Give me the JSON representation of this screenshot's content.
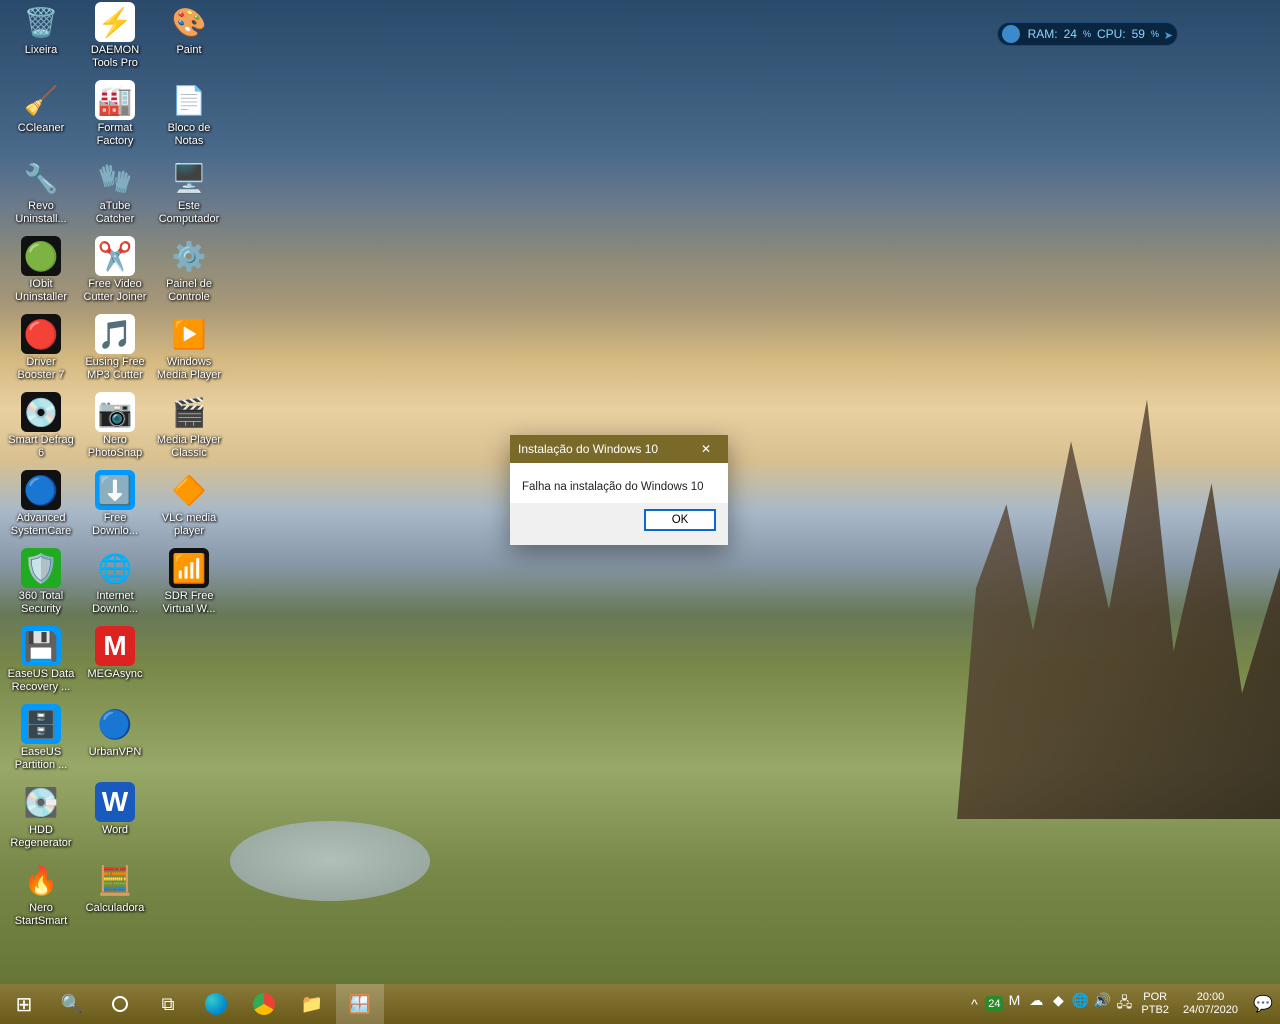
{
  "desktop_icons": [
    {
      "row": 0,
      "col": 0,
      "label": "Lixeira",
      "glyph": "🗑️",
      "bg": ""
    },
    {
      "row": 0,
      "col": 1,
      "label": "DAEMON Tools Pro",
      "glyph": "⚡",
      "bg": "#fff"
    },
    {
      "row": 0,
      "col": 2,
      "label": "Paint",
      "glyph": "🎨",
      "bg": ""
    },
    {
      "row": 1,
      "col": 0,
      "label": "CCleaner",
      "glyph": "🧹",
      "bg": ""
    },
    {
      "row": 1,
      "col": 1,
      "label": "Format Factory",
      "glyph": "🏭",
      "bg": "#fff"
    },
    {
      "row": 1,
      "col": 2,
      "label": "Bloco de Notas",
      "glyph": "📄",
      "bg": ""
    },
    {
      "row": 2,
      "col": 0,
      "label": "Revo Uninstall...",
      "glyph": "🔧",
      "bg": ""
    },
    {
      "row": 2,
      "col": 1,
      "label": "aTube Catcher",
      "glyph": "🧤",
      "bg": ""
    },
    {
      "row": 2,
      "col": 2,
      "label": "Este Computador",
      "glyph": "🖥️",
      "bg": ""
    },
    {
      "row": 3,
      "col": 0,
      "label": "IObit Uninstaller",
      "glyph": "🟢",
      "bg": "#111"
    },
    {
      "row": 3,
      "col": 1,
      "label": "Free Video Cutter Joiner",
      "glyph": "✂️",
      "bg": "#fff"
    },
    {
      "row": 3,
      "col": 2,
      "label": "Painel de Controle",
      "glyph": "⚙️",
      "bg": ""
    },
    {
      "row": 4,
      "col": 0,
      "label": "Driver Booster 7",
      "glyph": "🔴",
      "bg": "#111"
    },
    {
      "row": 4,
      "col": 1,
      "label": "Eusing Free MP3 Cutter",
      "glyph": "🎵",
      "bg": "#fff"
    },
    {
      "row": 4,
      "col": 2,
      "label": "Windows Media Player",
      "glyph": "▶️",
      "bg": ""
    },
    {
      "row": 5,
      "col": 0,
      "label": "Smart Defrag 6",
      "glyph": "💿",
      "bg": "#111"
    },
    {
      "row": 5,
      "col": 1,
      "label": "Nero PhotoSnap",
      "glyph": "📷",
      "bg": "#fff"
    },
    {
      "row": 5,
      "col": 2,
      "label": "Media Player Classic",
      "glyph": "🎬",
      "bg": ""
    },
    {
      "row": 6,
      "col": 0,
      "label": "Advanced SystemCare",
      "glyph": "🔵",
      "bg": "#111"
    },
    {
      "row": 6,
      "col": 1,
      "label": "Free Downlo...",
      "glyph": "⬇️",
      "bg": "#09f"
    },
    {
      "row": 6,
      "col": 2,
      "label": "VLC media player",
      "glyph": "🔶",
      "bg": ""
    },
    {
      "row": 7,
      "col": 0,
      "label": "360 Total Security",
      "glyph": "🛡️",
      "bg": "#2a2"
    },
    {
      "row": 7,
      "col": 1,
      "label": "Internet Downlo...",
      "glyph": "🌐",
      "bg": ""
    },
    {
      "row": 7,
      "col": 2,
      "label": "SDR Free Virtual W...",
      "glyph": "📶",
      "bg": "#111"
    },
    {
      "row": 8,
      "col": 0,
      "label": "EaseUS Data Recovery ...",
      "glyph": "💾",
      "bg": "#09f"
    },
    {
      "row": 8,
      "col": 1,
      "label": "MEGAsync",
      "glyph": "M",
      "bg": "#d22"
    },
    {
      "row": 9,
      "col": 0,
      "label": "EaseUS Partition ...",
      "glyph": "🗄️",
      "bg": "#09f"
    },
    {
      "row": 9,
      "col": 1,
      "label": "UrbanVPN",
      "glyph": "🔵",
      "bg": ""
    },
    {
      "row": 10,
      "col": 0,
      "label": "HDD Regenerator",
      "glyph": "💽",
      "bg": ""
    },
    {
      "row": 10,
      "col": 1,
      "label": "Word",
      "glyph": "W",
      "bg": "#185abd"
    },
    {
      "row": 11,
      "col": 0,
      "label": "Nero StartSmart",
      "glyph": "🔥",
      "bg": ""
    },
    {
      "row": 11,
      "col": 1,
      "label": "Calculadora",
      "glyph": "🧮",
      "bg": ""
    }
  ],
  "perf": {
    "ram_label": "RAM:",
    "ram_value": "24",
    "cpu_label": "CPU:",
    "cpu_value": "59",
    "pct": "%"
  },
  "dialog": {
    "title": "Instalação do Windows 10",
    "message": "Falha na instalação do Windows 10",
    "ok": "OK"
  },
  "taskbar": {
    "buttons": [
      {
        "name": "start",
        "glyph": "⊞"
      },
      {
        "name": "search",
        "glyph": "🔍"
      },
      {
        "name": "cortana",
        "glyph": "○"
      },
      {
        "name": "task-view",
        "glyph": "⧉"
      },
      {
        "name": "edge",
        "glyph": "🌐"
      },
      {
        "name": "chrome",
        "glyph": "⬤"
      },
      {
        "name": "file-explorer",
        "glyph": "📁"
      },
      {
        "name": "windows-setup",
        "glyph": "🪟",
        "active": true
      }
    ],
    "tray": {
      "chevron": "^",
      "temp_badge": "24",
      "icons": [
        "M",
        "☁",
        "◆",
        "🌐",
        "🔊",
        "🖧"
      ],
      "lang_top": "POR",
      "lang_bottom": "PTB2",
      "time": "20:00",
      "date": "24/07/2020",
      "notif": "💬"
    }
  }
}
